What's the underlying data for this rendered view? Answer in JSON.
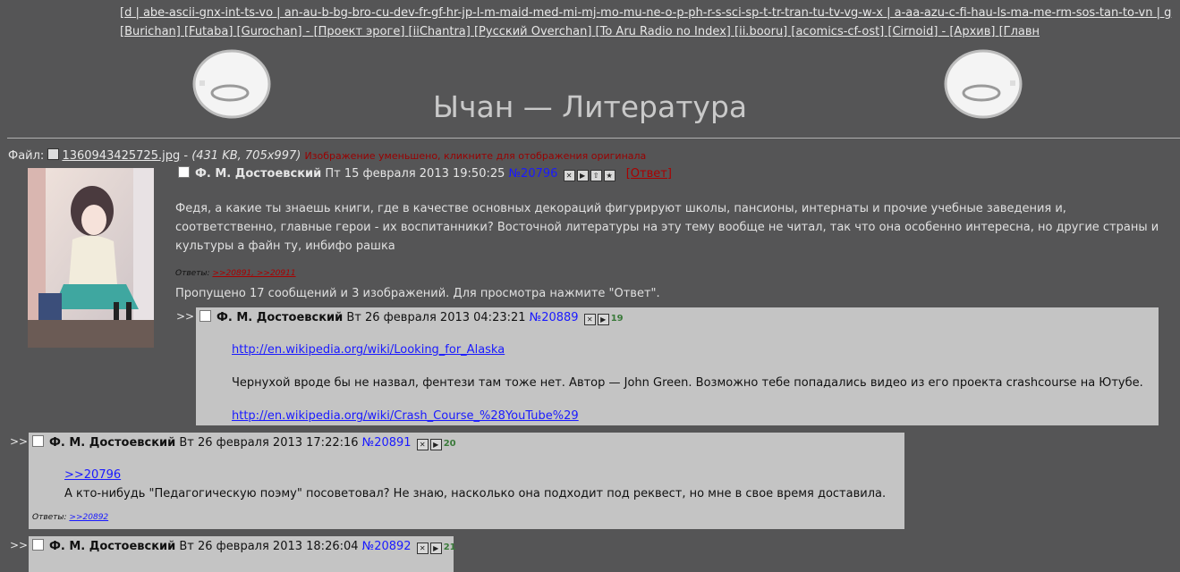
{
  "nav": {
    "line1": "[d | abe-ascii-gnx-int-ts-vo | an-au-b-bg-bro-cu-dev-fr-gf-hr-jp-l-m-maid-med-mi-mj-mo-mu-ne-o-p-ph-r-s-sci-sp-t-tr-tran-tu-tv-vg-w-x | a-aa-azu-c-fi-hau-ls-ma-me-rm-sos-tan-to-vn | g",
    "line2": "[Burichan] [Futaba] [Gurochan] - [Проект эроге] [iiChantra] [Русский Overchan] [To Aru Radio no Index] [ii.booru] [acomics-cf-ost] [Cirnoid] - [Архив] [Главн"
  },
  "board_title": "Ычан — Литература",
  "op": {
    "file_label": "Файл:",
    "file_name": "1360943425725.jpg",
    "file_sep": " - ",
    "file_meta": "(431 KB, 705x997)",
    "file_warning": "Изображение уменьшено, кликните для отображения оригинала",
    "author": "Ф. М. Достоевский",
    "date": "Пт 15 февраля 2013 19:50:25",
    "num": "№20796",
    "reply_link": "[Ответ]",
    "text": "Федя, а какие ты знаешь книги, где в качестве основных декораций фигурируют школы, пансионы, интернаты и прочие учебные заведения и, соответственно, главные герои - их воспитанники? Восточной литературы на эту тему вообще не читал, так что она особенно интересна, но другие страны и культуры а файн ту, инбифо рашка",
    "replies_label": "Ответы:",
    "replies": ">>20891, >>20911",
    "omitted": "Пропущено 17 сообщений и 3 изображений. Для просмотра нажмите \"Ответ\"."
  },
  "posts": [
    {
      "arrows": ">>",
      "author": "Ф. М. Достоевский",
      "date": "Вт 26 февраля 2013 04:23:21",
      "num": "№20889",
      "count": "19",
      "link1": "http://en.wikipedia.org/wiki/Looking_for_Alaska",
      "text": "Чернухой вроде бы не назвал, фентези там тоже нет. Автор — John Green. Возможно тебе попадались видео из его проекта crashcourse на Ютубе.",
      "link2": "http://en.wikipedia.org/wiki/Crash_Course_%28YouTube%29"
    },
    {
      "arrows": ">>",
      "author": "Ф. М. Достоевский",
      "date": "Вт 26 февраля 2013 17:22:16",
      "num": "№20891",
      "count": "20",
      "quote": ">>20796",
      "text": "А кто-нибудь \"Педагогическую поэму\" посоветовал? Не знаю, насколько она подходит под реквест, но мне в свое время доставила.",
      "replies_label": "Ответы:",
      "replies": ">>20892"
    },
    {
      "arrows": ">>",
      "author": "Ф. М. Достоевский",
      "date": "Вт 26 февраля 2013 18:26:04",
      "num": "№20892",
      "count": "21"
    }
  ]
}
